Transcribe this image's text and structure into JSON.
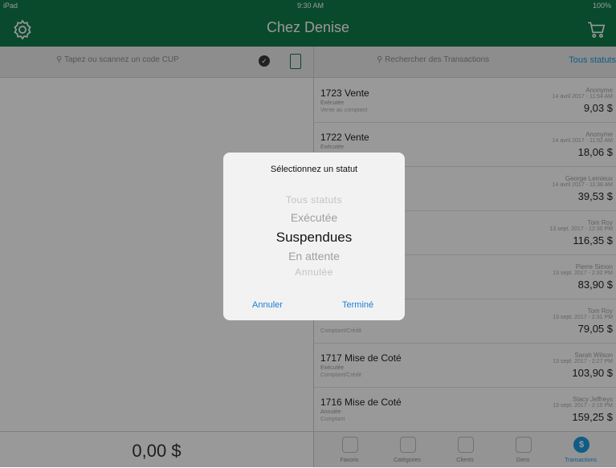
{
  "status_bar": {
    "carrier": "iPad",
    "time": "9:30 AM",
    "battery": "100%"
  },
  "nav": {
    "title": "Chez Denise",
    "settings_icon": "gear-icon",
    "cart_icon": "cart-icon"
  },
  "left_panel": {
    "search_placeholder": "Tapez ou scannez un code CUP",
    "total": "0,00 $"
  },
  "right_panel": {
    "search_placeholder": "Rechercher des Transactions",
    "status_filter": "Tous statuts"
  },
  "transactions": [
    {
      "title": "1723 Vente",
      "status": "Exécutée",
      "type": "Vente au comptant",
      "customer": "Anonyme",
      "date": "14 avril 2017 - 11:54 AM",
      "amount": "9,03 $"
    },
    {
      "title": "1722 Vente",
      "status": "Exécutée",
      "type": "",
      "customer": "Anonyme",
      "date": "14 avril 2017 - 11:52 AM",
      "amount": "18,06 $"
    },
    {
      "title": "",
      "status": "",
      "type": "",
      "customer": "George Lemieux",
      "date": "14 avril 2017 - 11:38 AM",
      "amount": "39,53 $"
    },
    {
      "title": "",
      "status": "",
      "type": "",
      "customer": "Tom Roy",
      "date": "13 sept. 2017 - 12:30 PM",
      "amount": "116,35 $"
    },
    {
      "title": "",
      "status": "",
      "type": "",
      "customer": "Pierre Simon",
      "date": "13 sept. 2017 - 2:32 PM",
      "amount": "83,90 $"
    },
    {
      "title": "",
      "status": "",
      "type": "Comptant/Crédit",
      "customer": "Tom Roy",
      "date": "13 sept. 2017 - 2:31 PM",
      "amount": "79,05 $"
    },
    {
      "title": "1717 Mise de Coté",
      "status": "Exécutée",
      "type": "Comptant/Crédit",
      "customer": "Sarah Wilson",
      "date": "13 sept. 2017 - 2:27 PM",
      "amount": "103,90 $"
    },
    {
      "title": "1716 Mise de Coté",
      "status": "Annulée",
      "type": "Comptant",
      "customer": "Stacy Jeffreys",
      "date": "13 sept. 2017 - 2:10 PM",
      "amount": "159,25 $"
    }
  ],
  "tabbar": [
    {
      "label": "Favoris",
      "icon": "heart-icon"
    },
    {
      "label": "Catégories",
      "icon": "grid-icon"
    },
    {
      "label": "Clients",
      "icon": "box-icon"
    },
    {
      "label": "Gens",
      "icon": "people-icon"
    },
    {
      "label": "Transactions",
      "icon": "dollar-icon",
      "glyph": "$",
      "active": true
    }
  ],
  "dialog": {
    "title": "Sélectionnez un statut",
    "options": [
      "Tous statuts",
      "Exécutée",
      "Suspendues",
      "En attente",
      "Annulée"
    ],
    "selected": "Suspendues",
    "cancel_label": "Annuler",
    "done_label": "Terminé"
  }
}
